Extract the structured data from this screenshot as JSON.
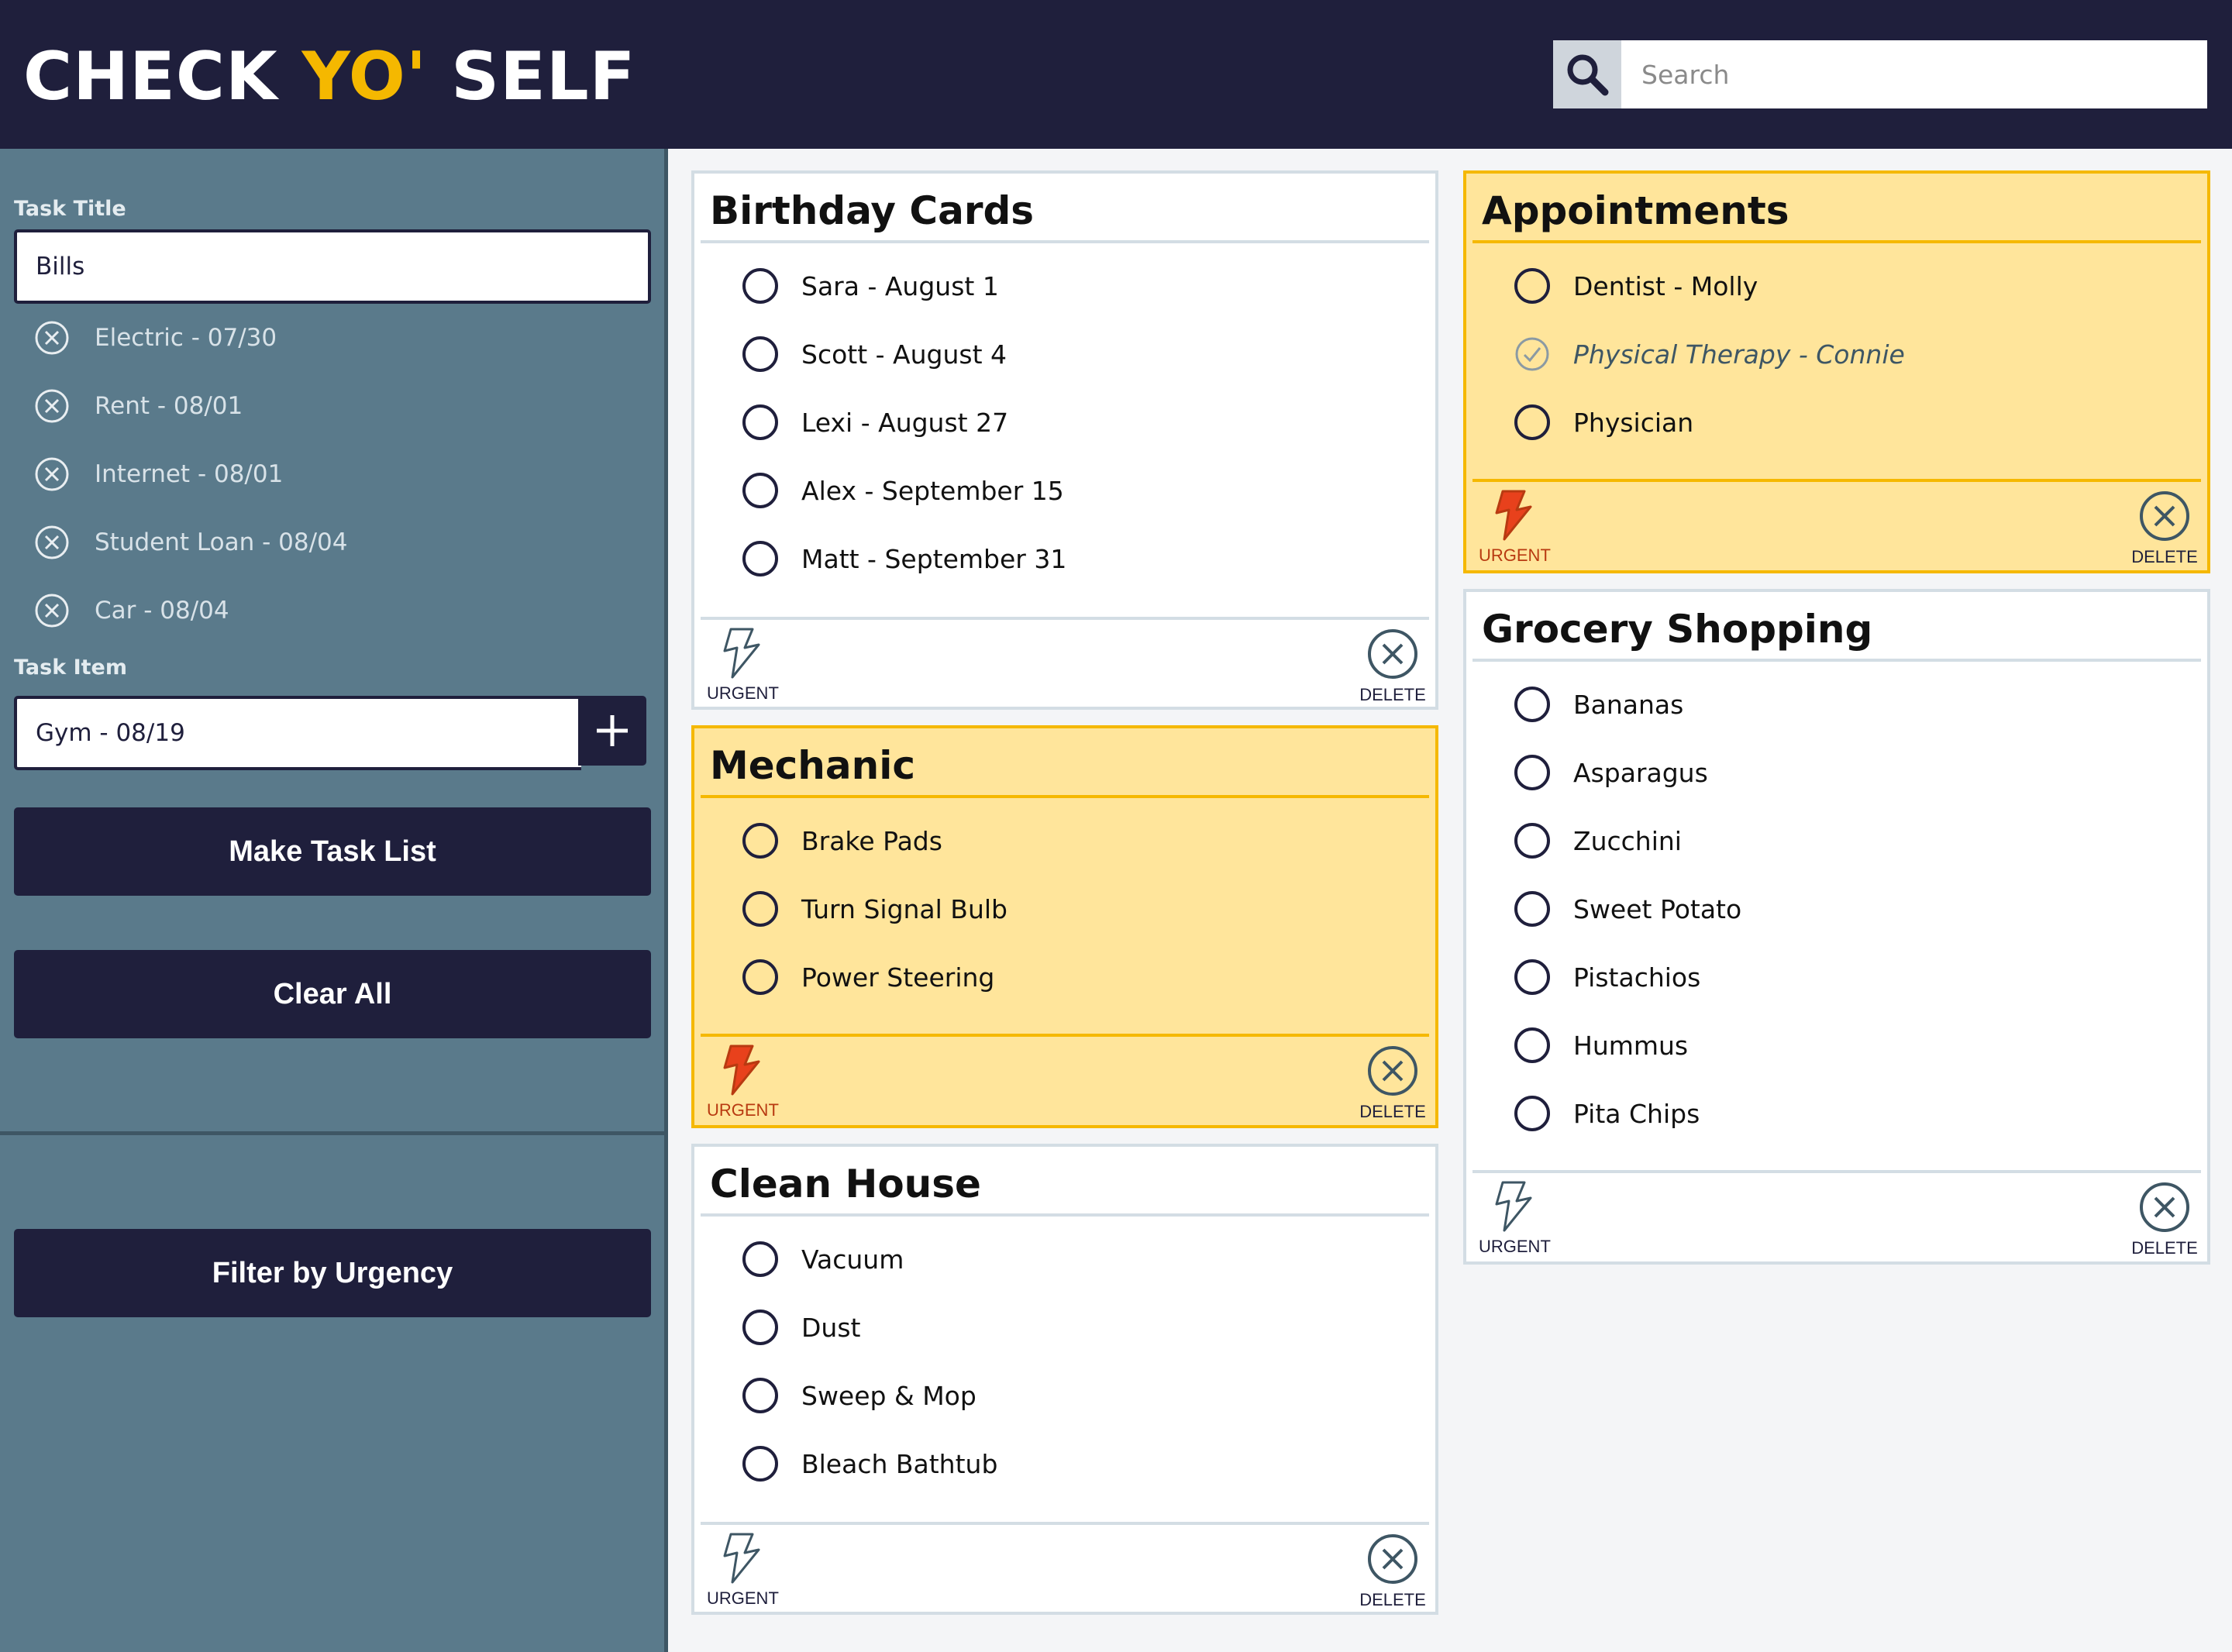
{
  "app": {
    "brand_part1": "CHECK ",
    "brand_accent": "YO'",
    "brand_part2": " SELF"
  },
  "search": {
    "placeholder": "Search",
    "icon": "search-icon"
  },
  "sidebar": {
    "task_title_label": "Task Title",
    "task_title_value": "Bills",
    "pending_items": [
      "Electric - 07/30",
      "Rent - 08/01",
      "Internet - 08/01",
      "Student Loan - 08/04",
      "Car - 08/04"
    ],
    "task_item_label": "Task Item",
    "task_item_value": "Gym - 08/19",
    "make_task_list": "Make Task List",
    "clear_all": "Clear All",
    "filter_by_urgency": "Filter by Urgency"
  },
  "card_controls": {
    "urgent": "URGENT",
    "delete": "DELETE"
  },
  "cards": [
    {
      "title": "Birthday Cards",
      "urgent": false,
      "items": [
        {
          "text": "Sara - August 1",
          "done": false
        },
        {
          "text": "Scott - August 4",
          "done": false
        },
        {
          "text": "Lexi - August 27",
          "done": false
        },
        {
          "text": "Alex - September 15",
          "done": false
        },
        {
          "text": "Matt - September 31",
          "done": false
        }
      ]
    },
    {
      "title": "Mechanic",
      "urgent": true,
      "items": [
        {
          "text": "Brake Pads",
          "done": false
        },
        {
          "text": "Turn Signal Bulb",
          "done": false
        },
        {
          "text": "Power Steering",
          "done": false
        }
      ]
    },
    {
      "title": "Clean House",
      "urgent": false,
      "items": [
        {
          "text": "Vacuum",
          "done": false
        },
        {
          "text": "Dust",
          "done": false
        },
        {
          "text": "Sweep & Mop",
          "done": false
        },
        {
          "text": "Bleach Bathtub",
          "done": false
        }
      ]
    },
    {
      "title": "Appointments",
      "urgent": true,
      "items": [
        {
          "text": "Dentist - Molly",
          "done": false
        },
        {
          "text": "Physical Therapy - Connie",
          "done": true
        },
        {
          "text": "Physician",
          "done": false
        }
      ]
    },
    {
      "title": "Grocery Shopping",
      "urgent": false,
      "items": [
        {
          "text": "Bananas",
          "done": false
        },
        {
          "text": "Asparagus",
          "done": false
        },
        {
          "text": "Zucchini",
          "done": false
        },
        {
          "text": "Sweet Potato",
          "done": false
        },
        {
          "text": "Pistachios",
          "done": false
        },
        {
          "text": "Hummus",
          "done": false
        },
        {
          "text": "Pita Chips",
          "done": false
        }
      ]
    }
  ],
  "colors": {
    "navy": "#1f1f3c",
    "accent_yellow": "#f5b800",
    "urgent_card_bg": "#ffe59b",
    "sidebar_bg": "#5a7a8b",
    "urgent_red": "#e8411c"
  }
}
